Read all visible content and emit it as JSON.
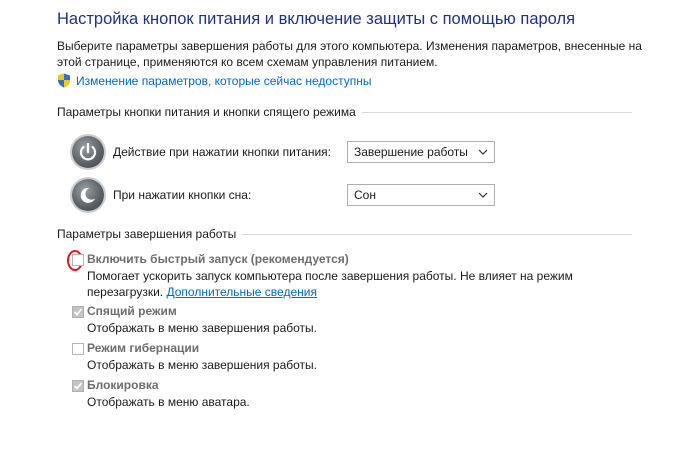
{
  "header": {
    "title": "Настройка кнопок питания и включение защиты с помощью пароля",
    "description": "Выберите параметры завершения работы для этого компьютера. Изменения параметров, внесенные на этой странице, применяются ко всем схемам управления питанием.",
    "change_link": "Изменение параметров, которые сейчас недоступны",
    "shield_icon": "uac-shield-icon"
  },
  "power_section": {
    "title": "Параметры кнопки питания и кнопки спящего режима",
    "rows": [
      {
        "label": "Действие при нажатии кнопки питания:",
        "value": "Завершение работы",
        "icon": "power-button-icon"
      },
      {
        "label": "При нажатии кнопки сна:",
        "value": "Сон",
        "icon": "sleep-button-icon"
      }
    ]
  },
  "shutdown_section": {
    "title": "Параметры завершения работы",
    "options": [
      {
        "title": "Включить быстрый запуск (рекомендуется)",
        "description": "Помогает ускорить запуск компьютера после завершения работы. Не влияет на режим перезагрузки.",
        "link": "Дополнительные сведения",
        "checked": false,
        "highlighted": true
      },
      {
        "title": "Спящий режим",
        "description": "Отображать в меню завершения работы.",
        "checked": true
      },
      {
        "title": "Режим гибернации",
        "description": "Отображать в меню завершения работы.",
        "checked": false
      },
      {
        "title": "Блокировка",
        "description": "Отображать в меню аватара.",
        "checked": true
      }
    ]
  },
  "colors": {
    "title": "#1e3287",
    "link": "#0066cc",
    "annotation": "#e0141e",
    "disabled_text": "#6d6d6d"
  }
}
